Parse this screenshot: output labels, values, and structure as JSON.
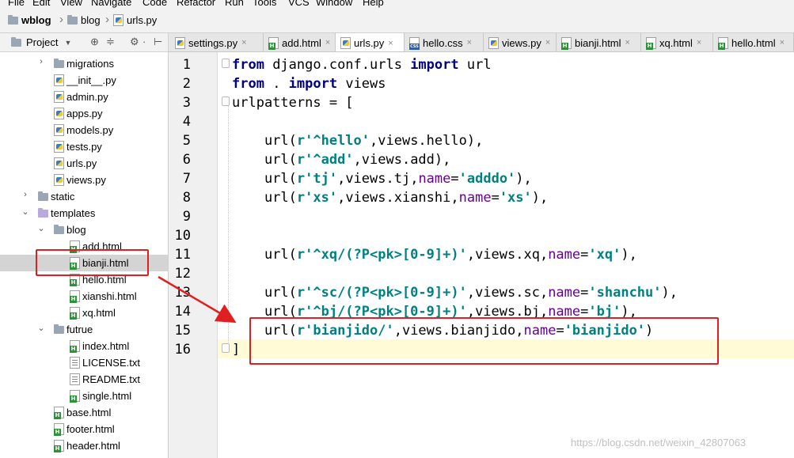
{
  "menu": [
    "File",
    "Edit",
    "View",
    "Navigate",
    "Code",
    "Refactor",
    "Run",
    "Tools",
    "VCS",
    "Window",
    "Help"
  ],
  "navbar": {
    "project": "wblog",
    "folder": "blog",
    "file": "urls.py"
  },
  "project_panel": {
    "title": "Project"
  },
  "tree": [
    {
      "label": "migrations",
      "kind": "folder",
      "arrow": "right"
    },
    {
      "label": "__init__.py",
      "kind": "py"
    },
    {
      "label": "admin.py",
      "kind": "py"
    },
    {
      "label": "apps.py",
      "kind": "py"
    },
    {
      "label": "models.py",
      "kind": "py"
    },
    {
      "label": "tests.py",
      "kind": "py"
    },
    {
      "label": "urls.py",
      "kind": "py"
    },
    {
      "label": "views.py",
      "kind": "py"
    },
    {
      "label": "static",
      "kind": "folder",
      "arrow": "right"
    },
    {
      "label": "templates",
      "kind": "folder-purple",
      "arrow": "down"
    },
    {
      "label": "blog",
      "kind": "folder",
      "arrow": "down"
    },
    {
      "label": "add.html",
      "kind": "html"
    },
    {
      "label": "bianji.html",
      "kind": "html",
      "selected": true
    },
    {
      "label": "hello.html",
      "kind": "html"
    },
    {
      "label": "xianshi.html",
      "kind": "html"
    },
    {
      "label": "xq.html",
      "kind": "html"
    },
    {
      "label": "futrue",
      "kind": "folder",
      "arrow": "down"
    },
    {
      "label": "index.html",
      "kind": "html"
    },
    {
      "label": "LICENSE.txt",
      "kind": "txt"
    },
    {
      "label": "README.txt",
      "kind": "txt"
    },
    {
      "label": "single.html",
      "kind": "html"
    },
    {
      "label": "base.html",
      "kind": "html"
    },
    {
      "label": "footer.html",
      "kind": "html"
    },
    {
      "label": "header.html",
      "kind": "html"
    }
  ],
  "tabs": [
    {
      "label": "settings.py",
      "kind": "py"
    },
    {
      "label": "add.html",
      "kind": "html"
    },
    {
      "label": "urls.py",
      "kind": "py",
      "active": true
    },
    {
      "label": "hello.css",
      "kind": "css"
    },
    {
      "label": "views.py",
      "kind": "py"
    },
    {
      "label": "bianji.html",
      "kind": "html"
    },
    {
      "label": "xq.html",
      "kind": "html"
    },
    {
      "label": "hello.html",
      "kind": "html"
    }
  ],
  "code_lines": [
    "from django.conf.urls import url",
    "from . import views",
    "urlpatterns = [",
    "",
    "    url(r'^hello',views.hello),",
    "    url(r'^add',views.add),",
    "    url(r'tj',views.tj,name='adddo'),",
    "    url(r'xs',views.xianshi,name='xs'),",
    "",
    "",
    "    url(r'^xq/(?P<pk>[0-9]+)',views.xq,name='xq'),",
    "",
    "    url(r'^sc/(?P<pk>[0-9]+)',views.sc,name='shanchu'),",
    "    url(r'^bj/(?P<pk>[0-9]+)',views.bj,name='bj'),",
    "    url(r'bianjido/',views.bianjido,name='bianjido')",
    "]"
  ],
  "watermark": "https://blog.csdn.net/weixin_42807063",
  "colors": {
    "annotation": "#e02020",
    "keyword": "#000080",
    "string": "#008080",
    "kwarg": "#660099"
  }
}
